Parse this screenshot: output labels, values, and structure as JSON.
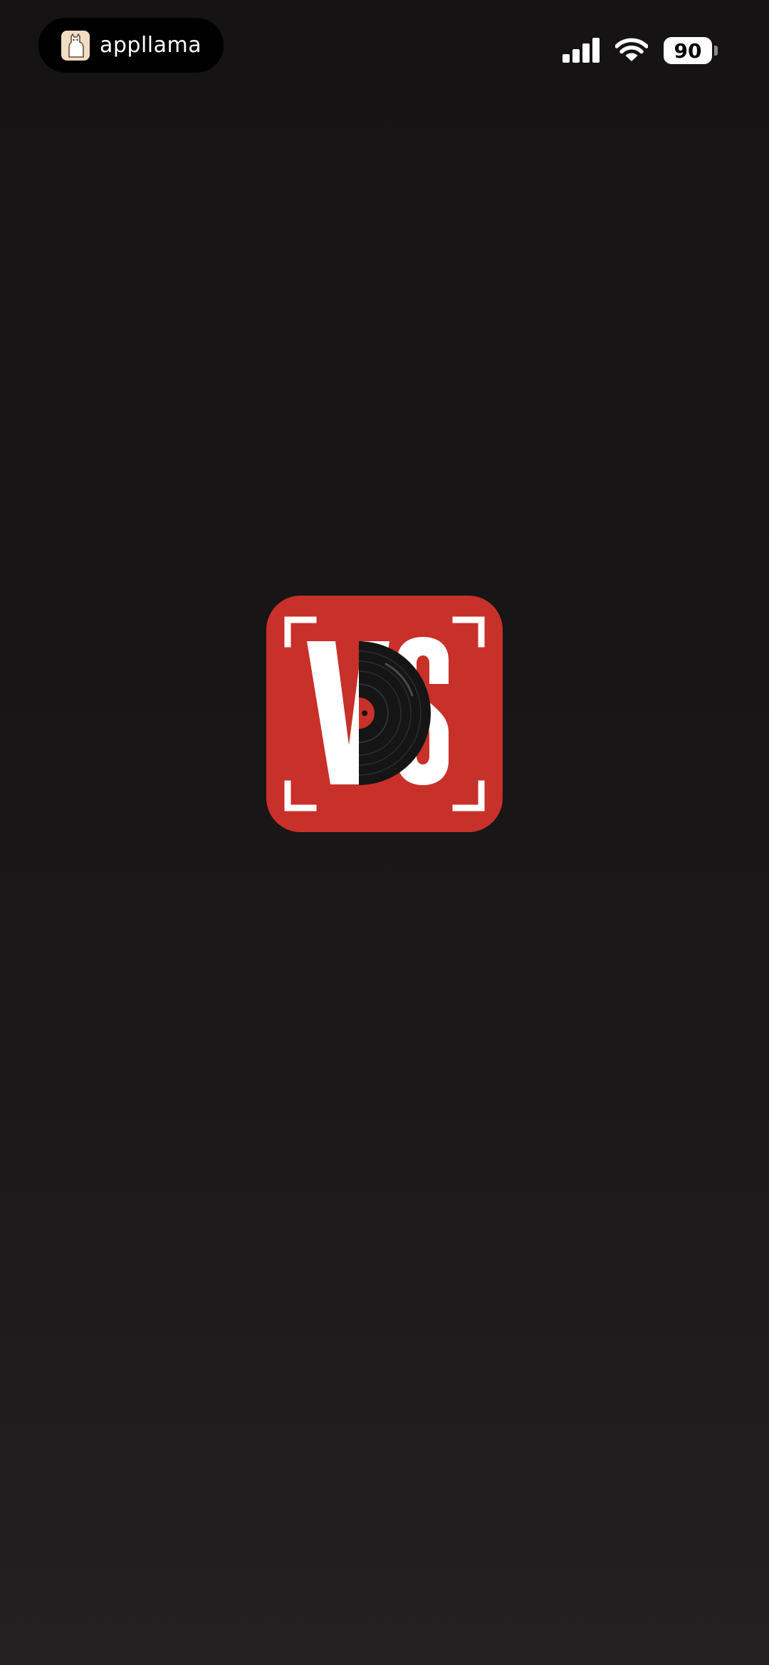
{
  "status_bar": {
    "app_badge_text": "appllama",
    "battery_level": "90",
    "signal_icon": "cellular-signal-icon",
    "wifi_icon": "wifi-icon"
  },
  "splash": {
    "logo_icon": "vs-record-logo-icon",
    "logo_letters": [
      "V",
      "S"
    ]
  },
  "colors": {
    "background": "#171515",
    "logo_red": "#C8302A",
    "logo_white": "#FFFFFF",
    "record_black": "#151515"
  }
}
